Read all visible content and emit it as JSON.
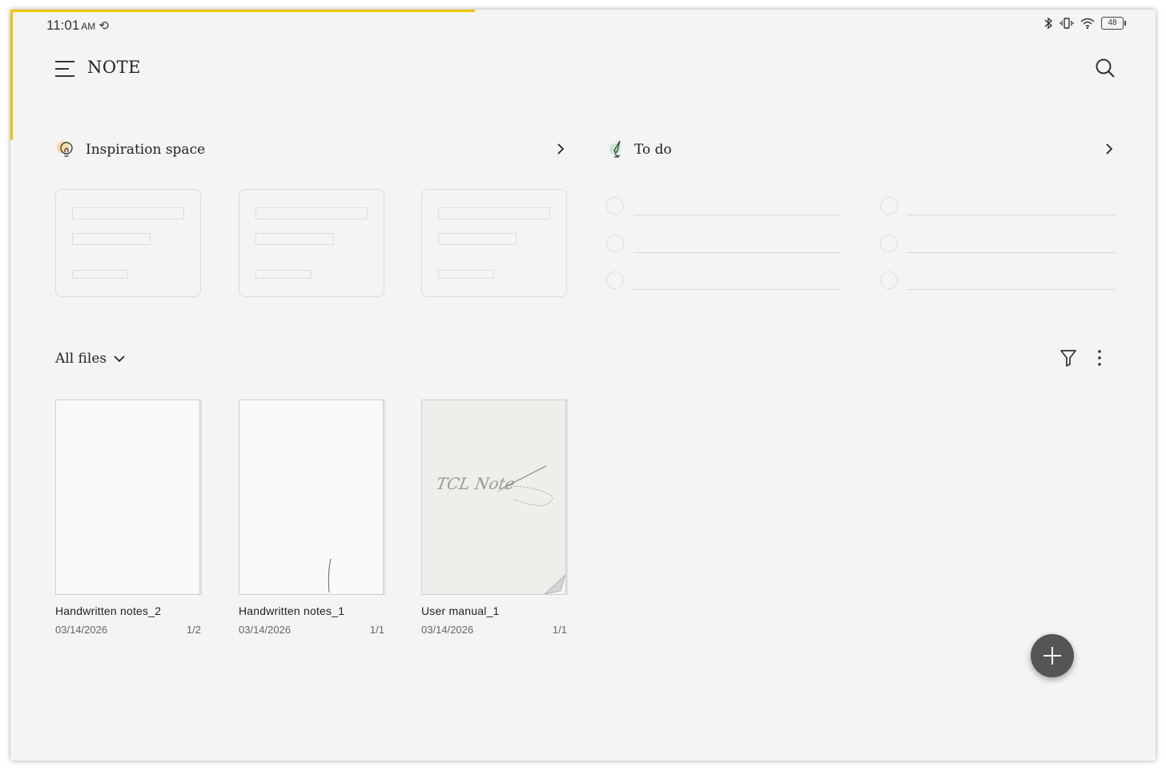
{
  "status_bar": {
    "time": "11:01",
    "ampm": "AM",
    "battery": "48"
  },
  "header": {
    "title": "NOTE"
  },
  "inspiration": {
    "title": "Inspiration space"
  },
  "todo": {
    "title": "To do"
  },
  "files_section": {
    "label": "All files"
  },
  "files": [
    {
      "name": "Handwritten notes_2",
      "date": "03/14/2026",
      "pages": "1/2"
    },
    {
      "name": "Handwritten notes_1",
      "date": "03/14/2026",
      "pages": "1/1"
    },
    {
      "name": "User manual_1",
      "date": "03/14/2026",
      "pages": "1/1",
      "thumb_text": "TCL Note"
    }
  ],
  "colors": {
    "accent": "#f2c500",
    "fab": "#555555",
    "background": "#f4f4f4"
  },
  "icons": [
    "menu-icon",
    "search-icon",
    "lightbulb-icon",
    "todo-icon",
    "chevron-right-icon",
    "chevron-down-icon",
    "filter-icon",
    "more-vert-icon",
    "plus-icon",
    "bluetooth-icon",
    "vibrate-icon",
    "wifi-icon",
    "battery-icon",
    "sync-icon"
  ]
}
